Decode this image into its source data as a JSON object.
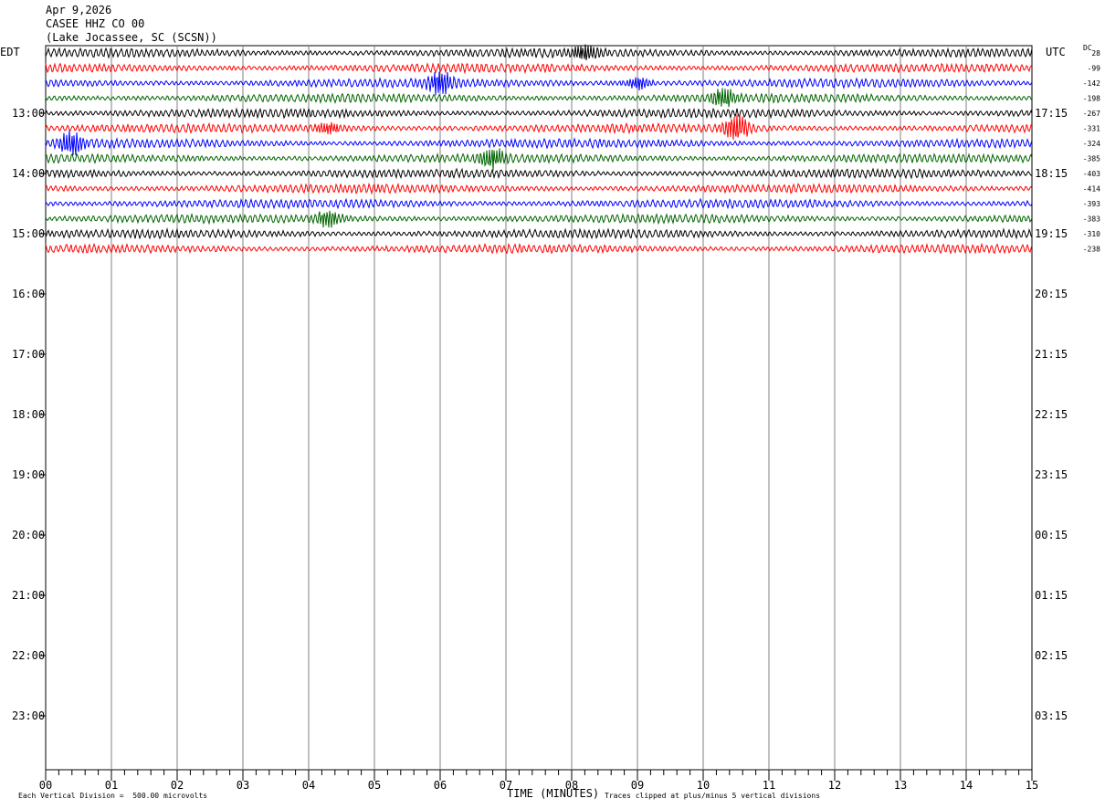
{
  "header": {
    "date": "Apr 9,2026",
    "station": "CASEE HHZ CO 00",
    "location": "(Lake Jocassee, SC (SCSN))"
  },
  "labels": {
    "left_zone": "EDT",
    "right_zone": "UTC",
    "dc": "DC",
    "xlabel": "TIME (MINUTES)",
    "scale_note": "Each Vertical Division =  500.00 microvolts",
    "clip_note": "Traces clipped at plus/minus 5 vertical divisions"
  },
  "chart_data": {
    "type": "line",
    "xlim": [
      0,
      15
    ],
    "x_ticks": [
      "00",
      "01",
      "02",
      "03",
      "04",
      "05",
      "06",
      "07",
      "08",
      "09",
      "10",
      "11",
      "12",
      "13",
      "14",
      "15"
    ],
    "rows_per_hour": 4,
    "left_hours": [
      "13:00",
      "14:00",
      "15:00",
      "16:00",
      "17:00",
      "18:00",
      "19:00",
      "20:00",
      "21:00",
      "22:00",
      "23:00"
    ],
    "right_hours": [
      "17:15",
      "18:15",
      "19:15",
      "20:15",
      "21:15",
      "22:15",
      "23:15",
      "00:15",
      "01:15",
      "02:15",
      "03:15"
    ],
    "trace_colors": [
      "#000000",
      "#ff0000",
      "#0000ff",
      "#006400"
    ],
    "dc_offsets": [
      "28",
      "-99",
      "-142",
      "-198",
      "-267",
      "-331",
      "-324",
      "-385",
      "-403",
      "-414",
      "-393",
      "-383",
      "-310",
      "-238"
    ],
    "events": [
      {
        "trace": 0,
        "minute": 8.2,
        "amp": 5
      },
      {
        "trace": 2,
        "minute": 6.0,
        "amp": 10
      },
      {
        "trace": 2,
        "minute": 9.0,
        "amp": 5
      },
      {
        "trace": 3,
        "minute": 10.3,
        "amp": 7
      },
      {
        "trace": 5,
        "minute": 4.3,
        "amp": 4
      },
      {
        "trace": 5,
        "minute": 10.5,
        "amp": 11
      },
      {
        "trace": 6,
        "minute": 0.4,
        "amp": 10
      },
      {
        "trace": 7,
        "minute": 6.8,
        "amp": 8
      },
      {
        "trace": 11,
        "minute": 4.3,
        "amp": 7
      }
    ]
  }
}
